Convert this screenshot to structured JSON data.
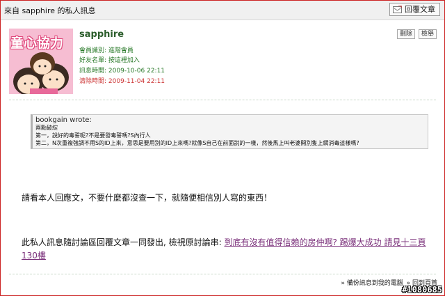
{
  "header": {
    "title": "來自 sapphire 的私人訊息",
    "reply_label": "回覆文章"
  },
  "sender": {
    "avatar_text": "童心協力",
    "username": "sapphire",
    "delete_label": "刪除",
    "report_label": "檢舉",
    "fields": [
      {
        "label": "會員識別:",
        "value": "進階會員"
      },
      {
        "label": "好友名單:",
        "value": "按這裡加入"
      },
      {
        "label": "訊息時間:",
        "value": "2009-10-06 22:11"
      },
      {
        "label": "清除時間:",
        "value": "2009-11-04 22:11"
      }
    ]
  },
  "quote": {
    "header": "bookgain wrote:",
    "lines": [
      "兩點破綻",
      "第一，說好的毒誓呢?不是要發毒誓嗎?S內行人",
      "第二，N次重複強調不用S的ID上來，意思是要用別的ID上來嗎?就像S自己在前面說的一樣，然後馬上叫老婆開別隻上網消毒這樣嗎?"
    ]
  },
  "message": "請看本人回應文，不要什麼都沒查一下，就隨便相信別人寫的東西！",
  "forward": {
    "prefix": "此私人訊息隨討論區回覆文章一同發出, 檢視原討論串: ",
    "link": "到底有沒有值得信賴的房仲啊? 踢爆大成功 請見十三頁130樓"
  },
  "footer": {
    "backup": "» 備份訊息到我的電腦",
    "top": "» 回到頁首"
  },
  "watermark": "#1080685",
  "colors": {
    "border": "#cc2222",
    "username": "#2c5e2c",
    "meta_green": "#2a7a2a",
    "meta_red": "#cc3333",
    "link": "#7a2f7a"
  }
}
